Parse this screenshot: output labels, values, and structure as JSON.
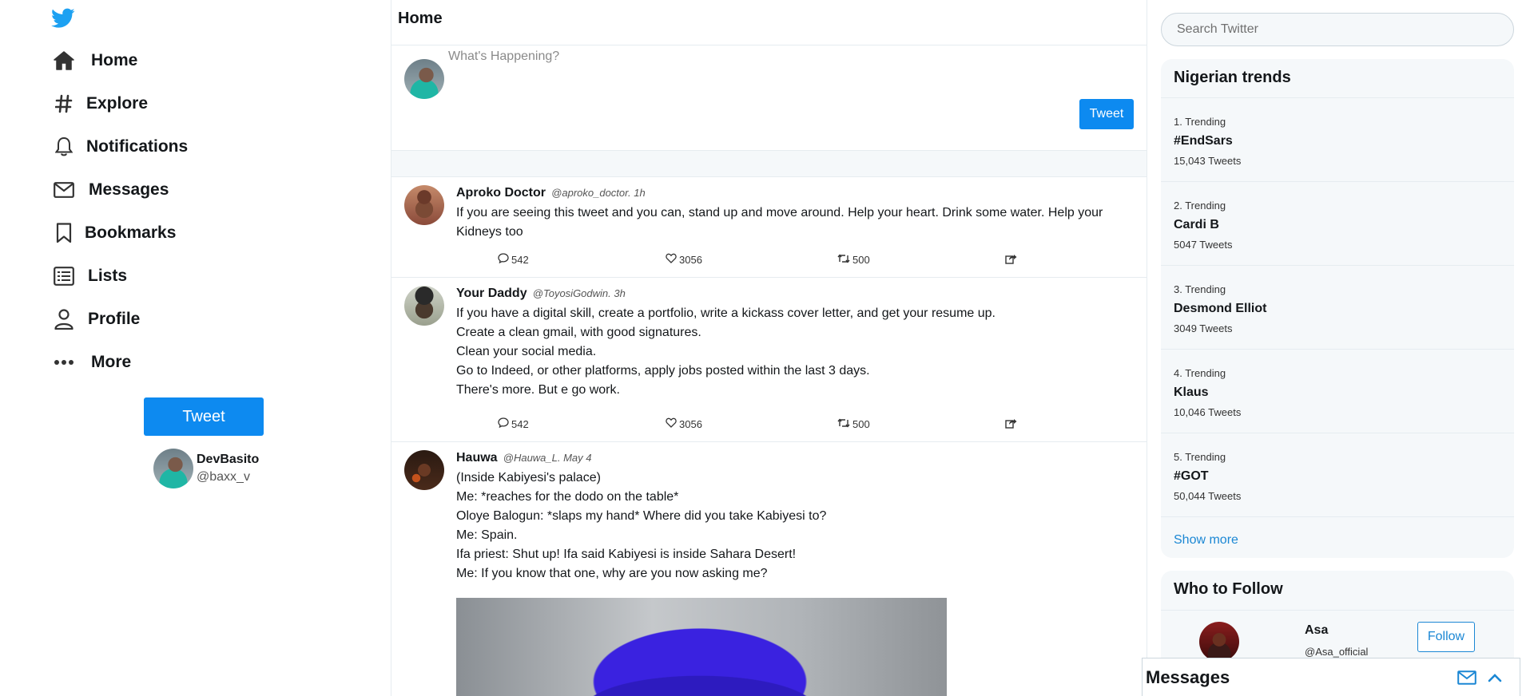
{
  "colors": {
    "accent": "#0d8af0",
    "link": "#1b87d4",
    "twitter_blue": "#1da1f2"
  },
  "sidebar": {
    "logo_icon": "twitter-bird-icon",
    "items": [
      {
        "label": "Home",
        "icon": "home-icon"
      },
      {
        "label": "Explore",
        "icon": "hashtag-icon"
      },
      {
        "label": "Notifications",
        "icon": "bell-icon"
      },
      {
        "label": "Messages",
        "icon": "envelope-icon"
      },
      {
        "label": "Bookmarks",
        "icon": "bookmark-icon"
      },
      {
        "label": "Lists",
        "icon": "list-icon"
      },
      {
        "label": "Profile",
        "icon": "user-icon"
      },
      {
        "label": "More",
        "icon": "more-dots-icon"
      }
    ],
    "tweet_button": "Tweet",
    "user": {
      "name": "DevBasito",
      "handle": "@baxx_v"
    }
  },
  "feed": {
    "title": "Home",
    "compose": {
      "placeholder": "What's Happening?",
      "button": "Tweet"
    },
    "tweets": [
      {
        "name": "Aproko Doctor",
        "handle": "@aproko_doctor. 1h",
        "lines": [
          "If you are seeing this tweet and you can, stand up and move around. Help your heart. Drink some water. Help your Kidneys too"
        ],
        "replies": "542",
        "likes": "3056",
        "retweets": "500"
      },
      {
        "name": "Your Daddy",
        "handle": "@ToyosiGodwin. 3h",
        "lines": [
          "If you have a digital skill, create a portfolio, write a kickass cover letter, and get your resume up.",
          "Create a clean gmail, with good signatures.",
          "Clean your social media.",
          "Go to Indeed, or other platforms, apply jobs posted within the last 3 days.",
          "There's more. But e go work."
        ],
        "replies": "542",
        "likes": "3056",
        "retweets": "500"
      },
      {
        "name": "Hauwa",
        "handle": "@Hauwa_L. May 4",
        "lines": [
          "(Inside Kabiyesi's palace)",
          "Me: *reaches for the dodo on the table*",
          "Oloye Balogun: *slaps my hand* Where did you take Kabiyesi to?",
          "Me: Spain.",
          "Ifa priest: Shut up! Ifa said Kabiyesi is inside Sahara Desert!",
          "Me: If you know that one, why are you now asking me?"
        ]
      }
    ]
  },
  "right": {
    "search_placeholder": "Search Twitter",
    "trends_title": "Nigerian trends",
    "trends": [
      {
        "rank": "1. Trending",
        "tag": "#EndSars",
        "count": "15,043 Tweets"
      },
      {
        "rank": "2. Trending",
        "tag": "Cardi B",
        "count": "5047 Tweets"
      },
      {
        "rank": "3. Trending",
        "tag": "Desmond Elliot",
        "count": "3049 Tweets"
      },
      {
        "rank": "4. Trending",
        "tag": "Klaus",
        "count": "10,046 Tweets"
      },
      {
        "rank": "5. Trending",
        "tag": "#GOT",
        "count": "50,044 Tweets"
      }
    ],
    "show_more": "Show more",
    "who_title": "Who to Follow",
    "follow": {
      "name": "Asa",
      "handle": "@Asa_official",
      "button": "Follow"
    }
  },
  "messages_dock": {
    "title": "Messages"
  }
}
